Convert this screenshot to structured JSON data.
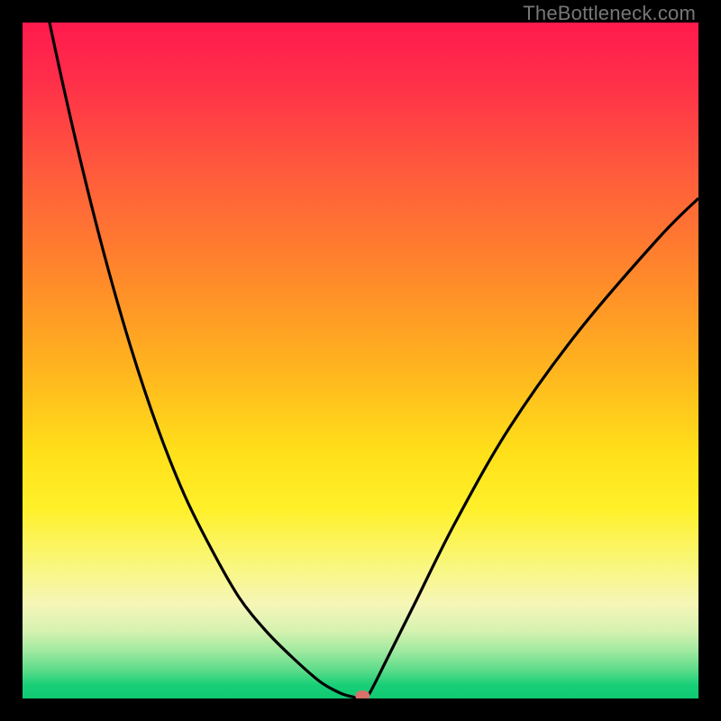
{
  "watermark": "TheBottleneck.com",
  "chart_data": {
    "type": "line",
    "title": "",
    "xlabel": "",
    "ylabel": "",
    "xlim": [
      0,
      100
    ],
    "ylim": [
      0,
      100
    ],
    "grid": false,
    "series": [
      {
        "name": "bottleneck-curve",
        "x": [
          0,
          4,
          8,
          12,
          16,
          20,
          24,
          28,
          32,
          36,
          40,
          44,
          47,
          49,
          50,
          51,
          52,
          54,
          58,
          64,
          72,
          82,
          94,
          100
        ],
        "y": [
          120,
          100,
          82,
          66,
          52,
          40,
          30,
          22,
          15,
          10,
          6,
          2.5,
          0.8,
          0.2,
          0,
          0.3,
          2,
          6,
          14,
          26,
          40,
          54,
          68,
          74
        ]
      }
    ],
    "marker": {
      "x": 50.3,
      "y": 0.4,
      "color": "#d6716a"
    },
    "annotations": []
  },
  "colors": {
    "frame": "#000000",
    "watermark": "#777777",
    "curve": "#000000",
    "marker": "#d6716a",
    "gradient_top": "#ff1a4d",
    "gradient_bottom": "#11c973"
  }
}
